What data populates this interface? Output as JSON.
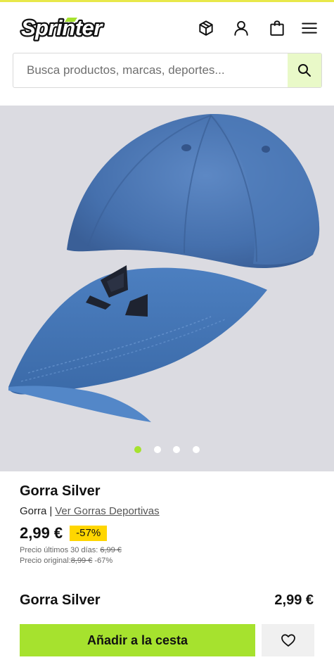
{
  "brand": {
    "name": "Sprinter",
    "accent": "#a6e22e"
  },
  "header": {
    "icons": [
      "package-icon",
      "user-icon",
      "shopping-bag-icon",
      "menu-icon"
    ]
  },
  "search": {
    "placeholder": "Busca productos, marcas, deportes...",
    "value": ""
  },
  "gallery": {
    "slide_count": 4,
    "active_slide": 1
  },
  "product": {
    "title": "Gorra Silver",
    "category": "Gorra",
    "separator": "|",
    "category_link": "Ver Gorras Deportivas",
    "price": "2,99 €",
    "discount_badge": "-57%",
    "last30_label": "Precio últimos 30 días:",
    "last30_price": "6,99 €",
    "original_label": "Precio original:",
    "original_price": "8,99 €",
    "original_discount": "-67%"
  },
  "sticky": {
    "title": "Gorra Silver",
    "price": "2,99 €",
    "add_to_cart_label": "Añadir a la cesta",
    "favorite_icon": "heart-icon"
  }
}
